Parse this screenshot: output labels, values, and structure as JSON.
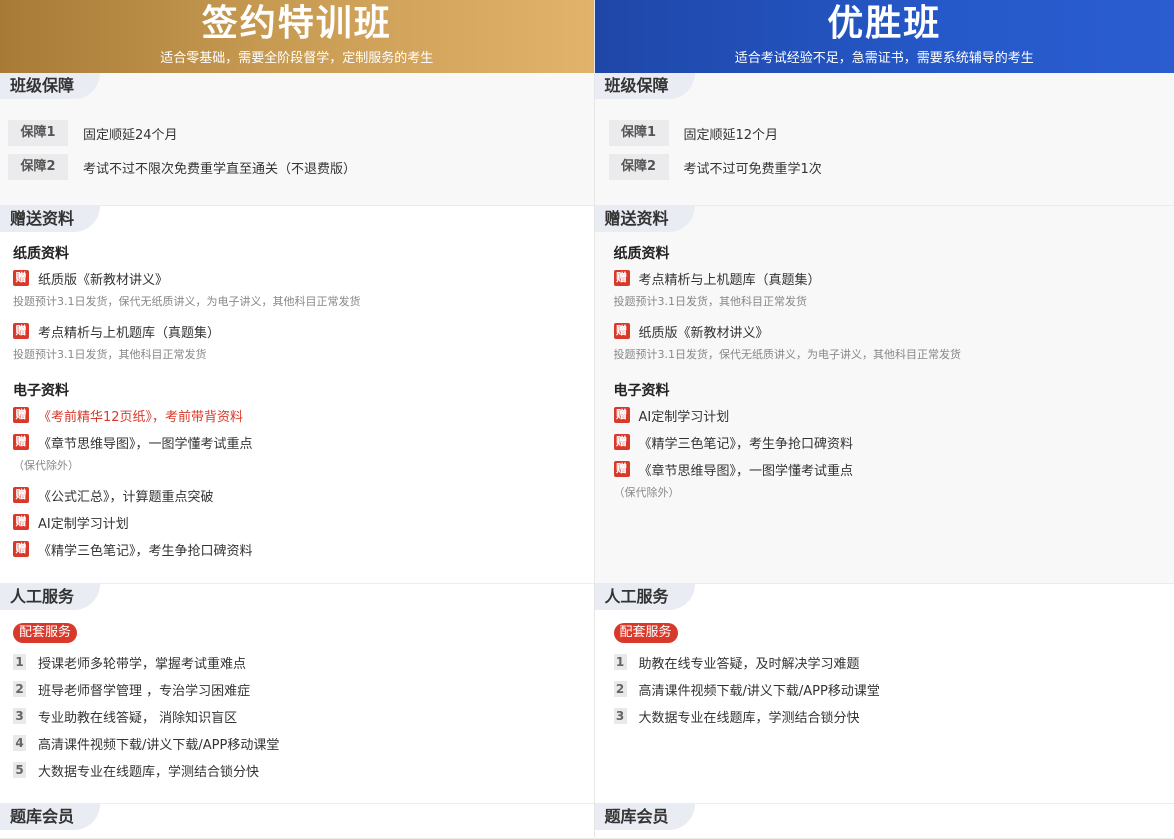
{
  "left": {
    "title": "签约特训班",
    "subtitle": "适合零基础，需要全阶段督学，定制服务的考生",
    "guarantee_heading": "班级保障",
    "guarantees": [
      {
        "badge": "保障1",
        "text": "固定顺延24个月"
      },
      {
        "badge": "保障2",
        "text": "考试不过不限次免费重学直至通关（不退费版）"
      }
    ],
    "gifts_heading": "赠送资料",
    "paper_heading": "纸质资料",
    "paper": [
      {
        "text": "纸质版《新教材讲义》",
        "note": "投题预计3.1日发货，保代无纸质讲义，为电子讲义，其他科目正常发货"
      },
      {
        "text": "考点精析与上机题库（真题集）",
        "note": "投题预计3.1日发货，其他科目正常发货"
      }
    ],
    "electronic_heading": "电子资料",
    "electronic": [
      {
        "text": "《考前精华12页纸》，考前带背资料"
      },
      {
        "text": "《章节思维导图》，一图学懂考试重点",
        "note": "（保代除外）"
      },
      {
        "text": "《公式汇总》，计算题重点突破"
      },
      {
        "text": "AI定制学习计划"
      },
      {
        "text": "《精学三色笔记》，考生争抢口碑资料"
      }
    ],
    "service_heading": "人工服务",
    "service_pill": "配套服务",
    "services": [
      {
        "num": "1",
        "text": "授课老师多轮带学，掌握考试重难点"
      },
      {
        "num": "2",
        "text": "班导老师督学管理 ，专治学习困难症"
      },
      {
        "num": "3",
        "text": "专业助教在线答疑， 消除知识盲区"
      },
      {
        "num": "4",
        "text": "高清课件视频下载/讲义下载/APP移动课堂"
      },
      {
        "num": "5",
        "text": "大数据专业在线题库，学测结合锁分快"
      }
    ],
    "bank_heading": "题库会员"
  },
  "right": {
    "title": "优胜班",
    "subtitle": "适合考试经验不足，急需证书，需要系统辅导的考生",
    "guarantee_heading": "班级保障",
    "guarantees": [
      {
        "badge": "保障1",
        "text": "固定顺延12个月"
      },
      {
        "badge": "保障2",
        "text": "考试不过可免费重学1次"
      }
    ],
    "gifts_heading": "赠送资料",
    "paper_heading": "纸质资料",
    "paper": [
      {
        "text": "考点精析与上机题库（真题集）",
        "note": "投题预计3.1日发货，其他科目正常发货"
      },
      {
        "text": "纸质版《新教材讲义》",
        "note": "投题预计3.1日发货，保代无纸质讲义，为电子讲义，其他科目正常发货"
      }
    ],
    "electronic_heading": "电子资料",
    "electronic": [
      {
        "text": "AI定制学习计划"
      },
      {
        "text": "《精学三色笔记》，考生争抢口碑资料"
      },
      {
        "text": "《章节思维导图》，一图学懂考试重点",
        "note": "（保代除外）"
      }
    ],
    "service_heading": "人工服务",
    "service_pill": "配套服务",
    "services": [
      {
        "num": "1",
        "text": "助教在线专业答疑，及时解决学习难题"
      },
      {
        "num": "2",
        "text": "高清课件视频下载/讲义下载/APP移动课堂"
      },
      {
        "num": "3",
        "text": "大数据专业在线题库，学测结合锁分快"
      }
    ],
    "bank_heading": "题库会员"
  },
  "gift_icon": "赠",
  "colors": {
    "accent_red": "#d9392b",
    "gold": "#c79a52",
    "blue": "#2558c8"
  }
}
